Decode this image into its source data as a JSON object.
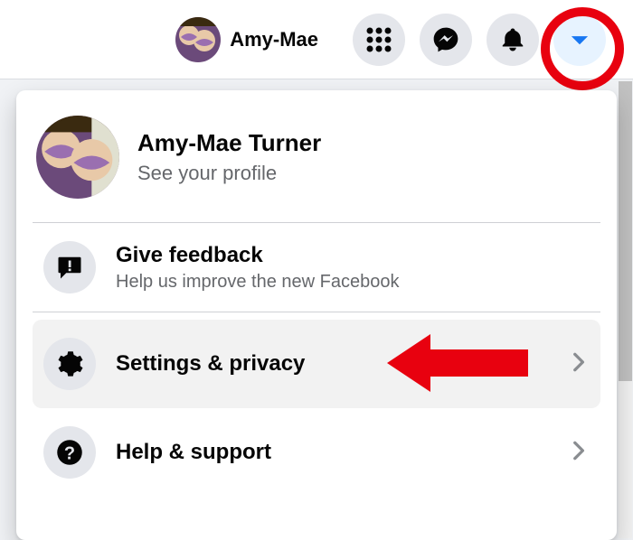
{
  "topbar": {
    "profile_name": "Amy-Mae",
    "icons": {
      "menu": "menu-grid-icon",
      "messenger": "messenger-icon",
      "notifications": "bell-icon",
      "account": "caret-down-icon"
    }
  },
  "dropdown": {
    "profile": {
      "name": "Amy-Mae Turner",
      "subtitle": "See your profile"
    },
    "feedback": {
      "label": "Give feedback",
      "subtitle": "Help us improve the new Facebook"
    },
    "settings": {
      "label": "Settings & privacy"
    },
    "help": {
      "label": "Help & support"
    }
  },
  "colors": {
    "accent": "#1877f2",
    "highlight": "#e8010f"
  }
}
